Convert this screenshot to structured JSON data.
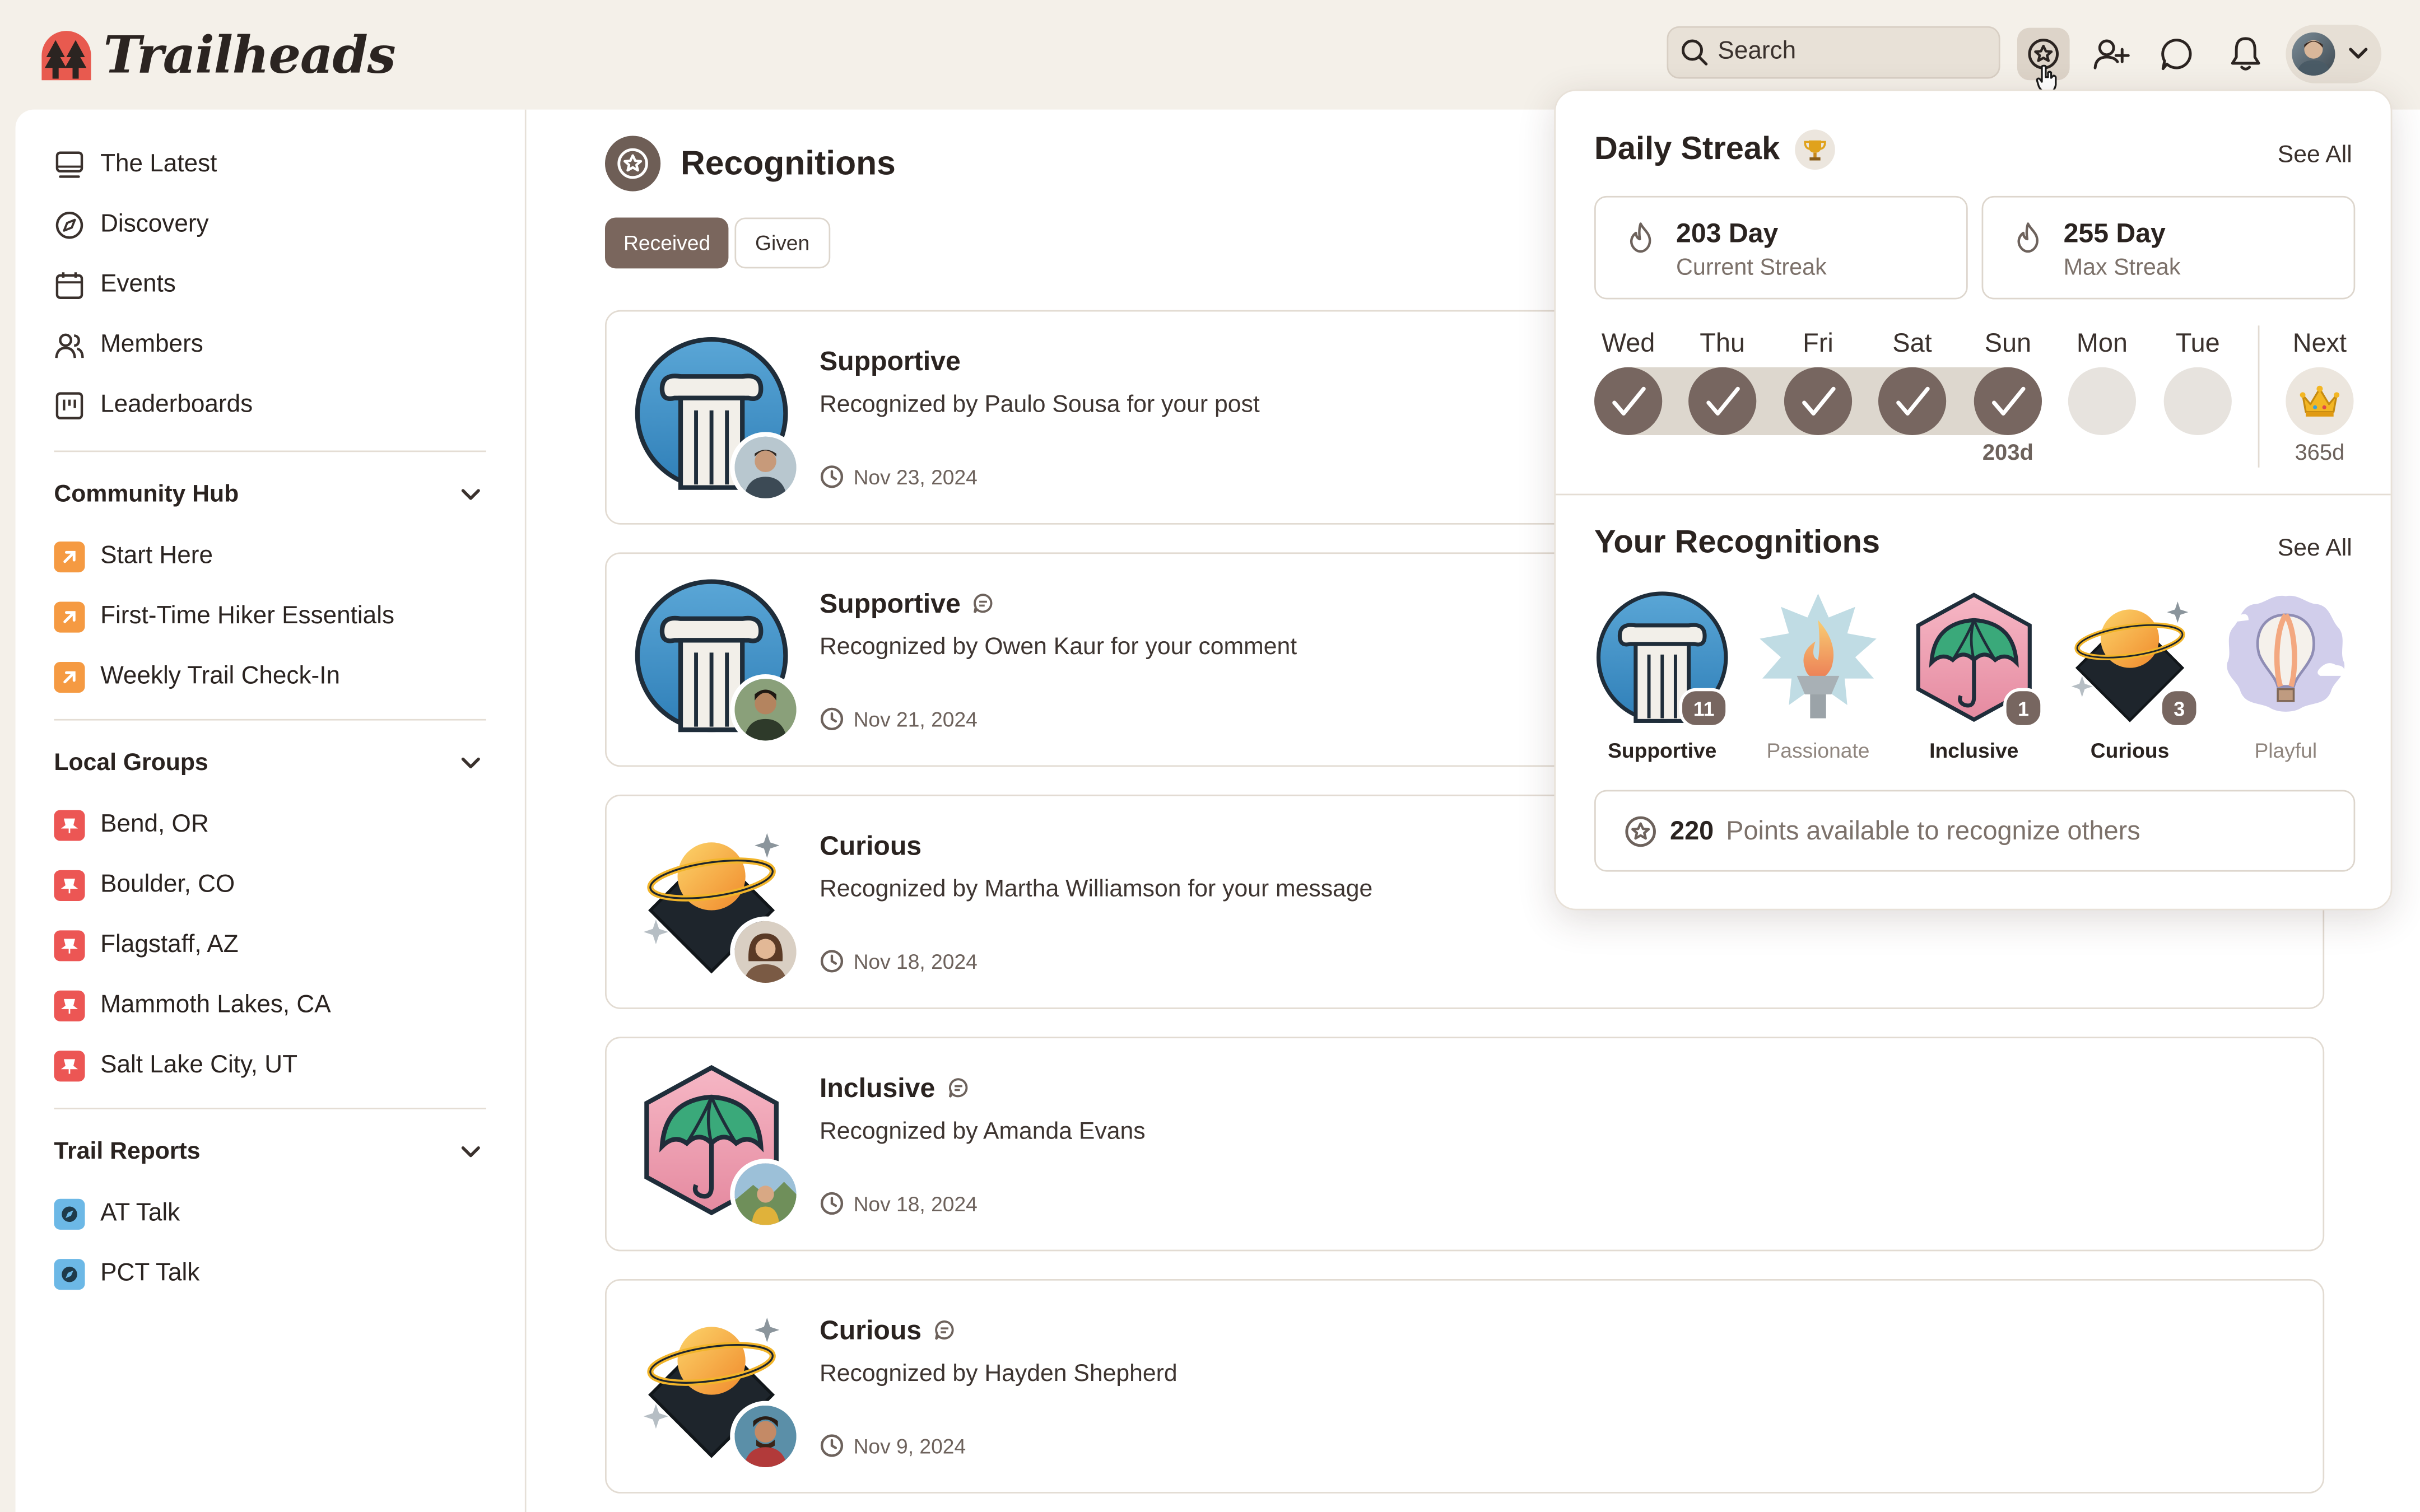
{
  "app": {
    "name": "Trailheads",
    "search_placeholder": "Search"
  },
  "topbar": {
    "icons": [
      "recognition-star-icon",
      "add-user-icon",
      "chat-icon",
      "bell-icon",
      "chevron-down-icon"
    ]
  },
  "sidebar": {
    "primary": [
      {
        "label": "The Latest",
        "icon": "monitor-icon"
      },
      {
        "label": "Discovery",
        "icon": "compass-icon"
      },
      {
        "label": "Events",
        "icon": "calendar-icon"
      },
      {
        "label": "Members",
        "icon": "members-icon"
      },
      {
        "label": "Leaderboards",
        "icon": "leaderboard-icon"
      }
    ],
    "community_hub": {
      "title": "Community Hub",
      "items": [
        "Start Here",
        "First-Time Hiker Essentials",
        "Weekly Trail Check-In"
      ]
    },
    "local_groups": {
      "title": "Local Groups",
      "items": [
        "Bend, OR",
        "Boulder, CO",
        "Flagstaff, AZ",
        "Mammoth Lakes, CA",
        "Salt Lake City, UT"
      ]
    },
    "trail_reports": {
      "title": "Trail Reports",
      "items": [
        "AT Talk",
        "PCT Talk"
      ]
    }
  },
  "main": {
    "title": "Recognitions",
    "tabs": [
      {
        "label": "Received",
        "active": true
      },
      {
        "label": "Given",
        "active": false
      }
    ],
    "cards": [
      {
        "badge": "Supportive",
        "has_comment_icon": false,
        "desc": "Recognized by Paulo Sousa for your post",
        "date": "Nov 23, 2024"
      },
      {
        "badge": "Supportive",
        "has_comment_icon": true,
        "desc": "Recognized by Owen Kaur for your comment",
        "date": "Nov 21, 2024"
      },
      {
        "badge": "Curious",
        "has_comment_icon": false,
        "desc": "Recognized by Martha Williamson for your message",
        "date": "Nov 18, 2024"
      },
      {
        "badge": "Inclusive",
        "has_comment_icon": true,
        "desc": "Recognized by Amanda Evans",
        "date": "Nov 18, 2024"
      },
      {
        "badge": "Curious",
        "has_comment_icon": true,
        "desc": "Recognized by Hayden Shepherd",
        "date": "Nov 9, 2024"
      }
    ]
  },
  "popover": {
    "streak_title": "Daily Streak",
    "see_all": "See All",
    "current": {
      "value": "203 Day",
      "label": "Current Streak"
    },
    "max": {
      "value": "255 Day",
      "label": "Max Streak"
    },
    "days": [
      {
        "label": "Wed",
        "done": true
      },
      {
        "label": "Thu",
        "done": true
      },
      {
        "label": "Fri",
        "done": true
      },
      {
        "label": "Sat",
        "done": true
      },
      {
        "label": "Sun",
        "done": true
      },
      {
        "label": "Mon",
        "done": false
      },
      {
        "label": "Tue",
        "done": false
      }
    ],
    "today_count": "203d",
    "next": {
      "label": "Next",
      "count": "365d"
    },
    "recog_title": "Your Recognitions",
    "recog_see_all": "See All",
    "recognitions": [
      {
        "label": "Supportive",
        "count": "11",
        "dim": false
      },
      {
        "label": "Passionate",
        "count": "",
        "dim": true
      },
      {
        "label": "Inclusive",
        "count": "1",
        "dim": false
      },
      {
        "label": "Curious",
        "count": "3",
        "dim": false
      },
      {
        "label": "Playful",
        "count": "",
        "dim": true
      }
    ],
    "points_value": "220",
    "points_text": "Points available to recognize others"
  },
  "colors": {
    "accent_brown": "#776660",
    "background": "#f4f0e9",
    "logo_red": "#e85a4f",
    "chip_orange": "#f59a42",
    "chip_red": "#ec5654",
    "chip_blue": "#6cb8e6"
  }
}
